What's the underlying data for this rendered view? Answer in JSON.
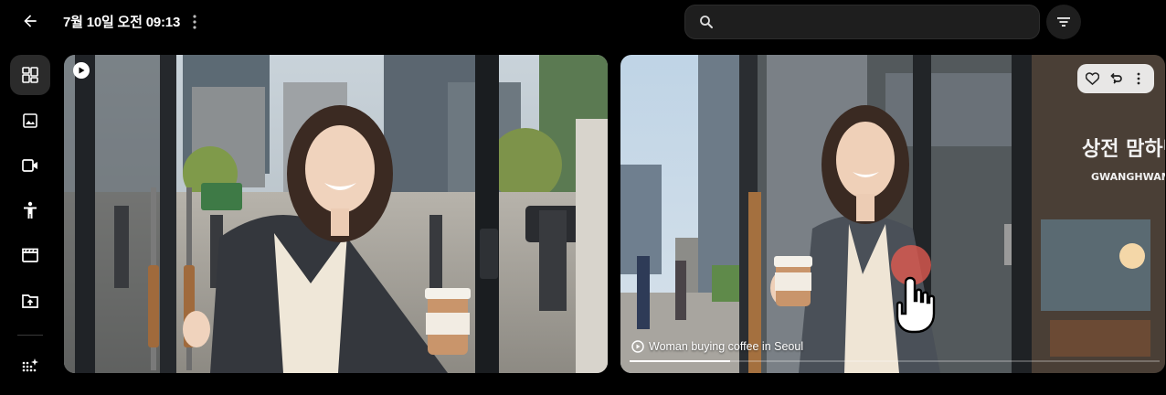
{
  "header": {
    "title": "7월 10일 오전 09:13",
    "search_placeholder": "",
    "back_icon": "arrow-back-icon",
    "menu_icon": "more-vertical-icon",
    "filter_icon": "filter-icon"
  },
  "sidebar": {
    "items": [
      {
        "icon": "dashboard-grid-icon",
        "active": true
      },
      {
        "icon": "image-icon",
        "active": false
      },
      {
        "icon": "video-camera-icon",
        "active": false
      },
      {
        "icon": "person-icon",
        "active": false
      },
      {
        "icon": "clapperboard-icon",
        "active": false
      },
      {
        "icon": "folder-upload-icon",
        "active": false
      },
      {
        "icon": "sparkle-grid-icon",
        "active": false
      }
    ]
  },
  "cards": [
    {
      "type": "video",
      "badge_icon": "play-icon"
    },
    {
      "type": "video",
      "caption": "Woman buying coffee in Seoul",
      "progress": 0.19,
      "actions": [
        "heart-icon",
        "reuse-prompt-icon",
        "more-vertical-icon"
      ]
    }
  ],
  "scene_text": {
    "store_sign_korean": "상전 맘하던",
    "store_sign_latin": "GWANGHWAMUN, S"
  },
  "colors": {
    "background": "#000000",
    "surface": "#1e1e1e",
    "active_nav": "#2b2b2b"
  }
}
